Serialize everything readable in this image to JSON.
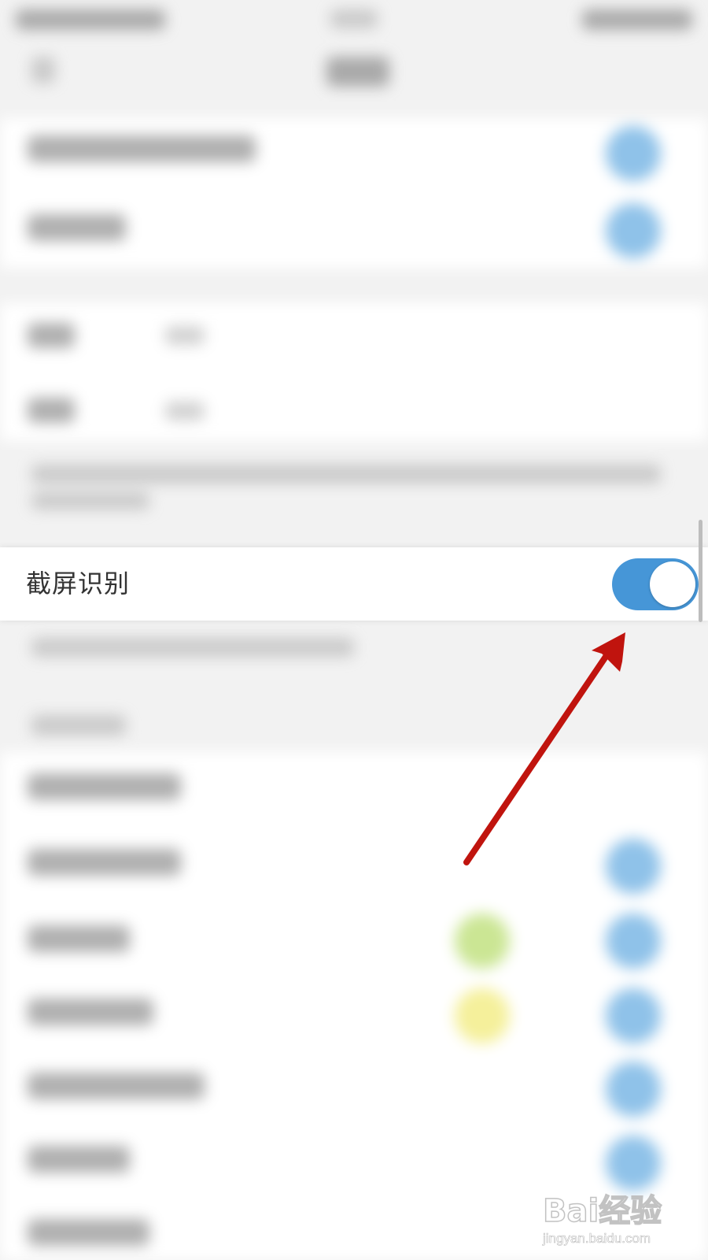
{
  "screen": {
    "focused_setting": {
      "label": "截屏识别",
      "toggle_on": true,
      "toggle_color": "#4696d7"
    },
    "annotation": {
      "arrow_color": "#c0140e"
    },
    "watermark": {
      "logo_text": "Bai经验",
      "url": "jingyan.baidu.com"
    }
  }
}
